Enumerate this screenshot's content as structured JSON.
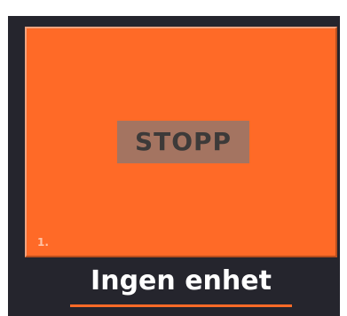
{
  "tile": {
    "label": "STOPP",
    "index": "1.",
    "color": "#ff6a27"
  },
  "device": {
    "name": "Ingen enhet"
  },
  "theme": {
    "background": "#25252d",
    "label_background": "#a47461",
    "accent": "#ff6a27"
  }
}
